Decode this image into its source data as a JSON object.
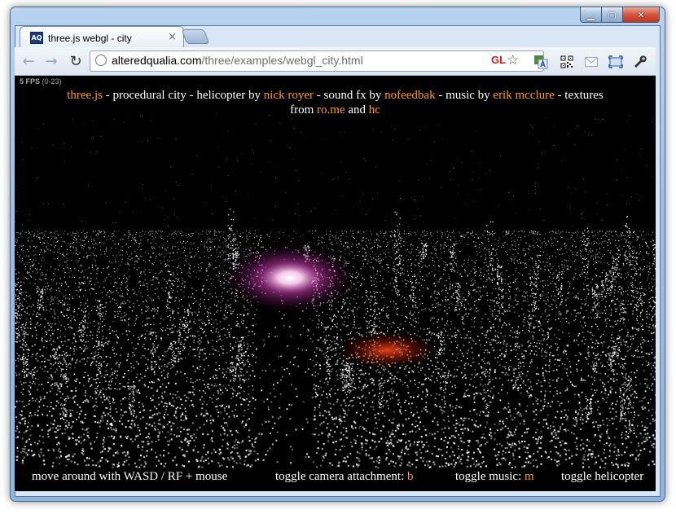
{
  "window": {
    "title": "three.js webgl - city",
    "favicon_text": "AQ",
    "tab_close": "×"
  },
  "toolbar": {
    "back_icon": "←",
    "forward_icon": "→",
    "reload_icon": "↻",
    "url_host": "alteredqualia.com",
    "url_path": "/three/examples/webgl_city.html",
    "gl_badge": "GL",
    "star_icon": "☆"
  },
  "stats": {
    "fps_label": "5 FPS",
    "fps_range": "(0-23)"
  },
  "info": {
    "link1": "three.js",
    "t1": " - procedural city - helicopter by ",
    "link2": "nick royer",
    "t2": " - sound fx by ",
    "link3": "nofeedbak",
    "t3": " - music by ",
    "link4": "erik mcclure",
    "t4": " - textures",
    "t5": "from ",
    "link5": "ro.me",
    "t6": " and ",
    "link6": "hc"
  },
  "controls": {
    "move": "move around with WASD / RF + mouse",
    "camera": "toggle camera attachment: ",
    "camera_key": "b",
    "music": "toggle music: ",
    "music_key": "m",
    "heli": "toggle helicopter"
  },
  "colors": {
    "link": "#ff9b1a",
    "fps": "#a6a6a6",
    "gl_badge": "#d21b1b"
  }
}
